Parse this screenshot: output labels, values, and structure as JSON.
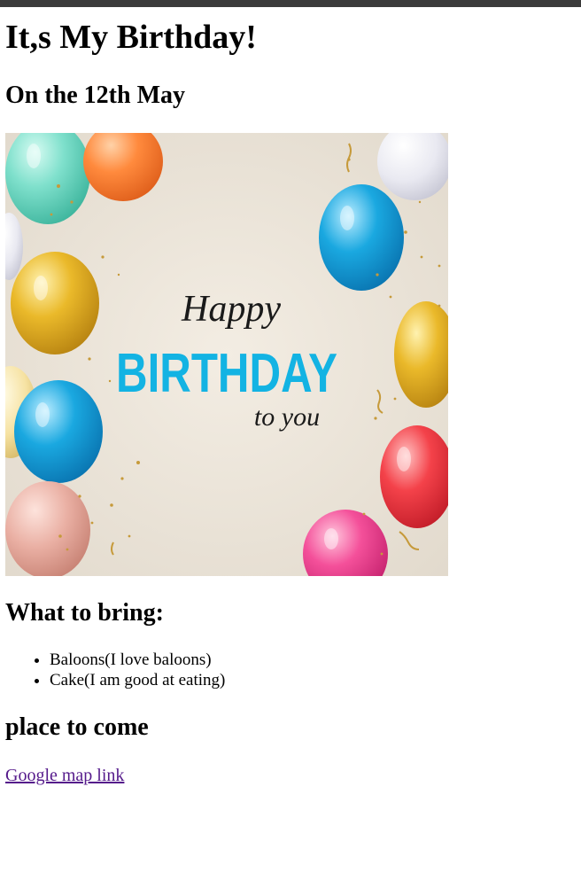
{
  "header": {
    "title": "It,s My Birthday!",
    "date": "On the 12th May"
  },
  "hero_image": {
    "script_word": "Happy",
    "main_word": "BIRTHDAY",
    "sub_word": "to you",
    "colors": {
      "background": "#ece5da",
      "main_text": "#13b3e3",
      "script_text": "#1a1a1a",
      "confetti": "#c69a3a"
    }
  },
  "bring": {
    "heading": "What to bring:",
    "items": [
      "Baloons(I love baloons)",
      "Cake(I am good at eating)"
    ]
  },
  "place": {
    "heading": "place to come",
    "link_text": "Google map link"
  }
}
